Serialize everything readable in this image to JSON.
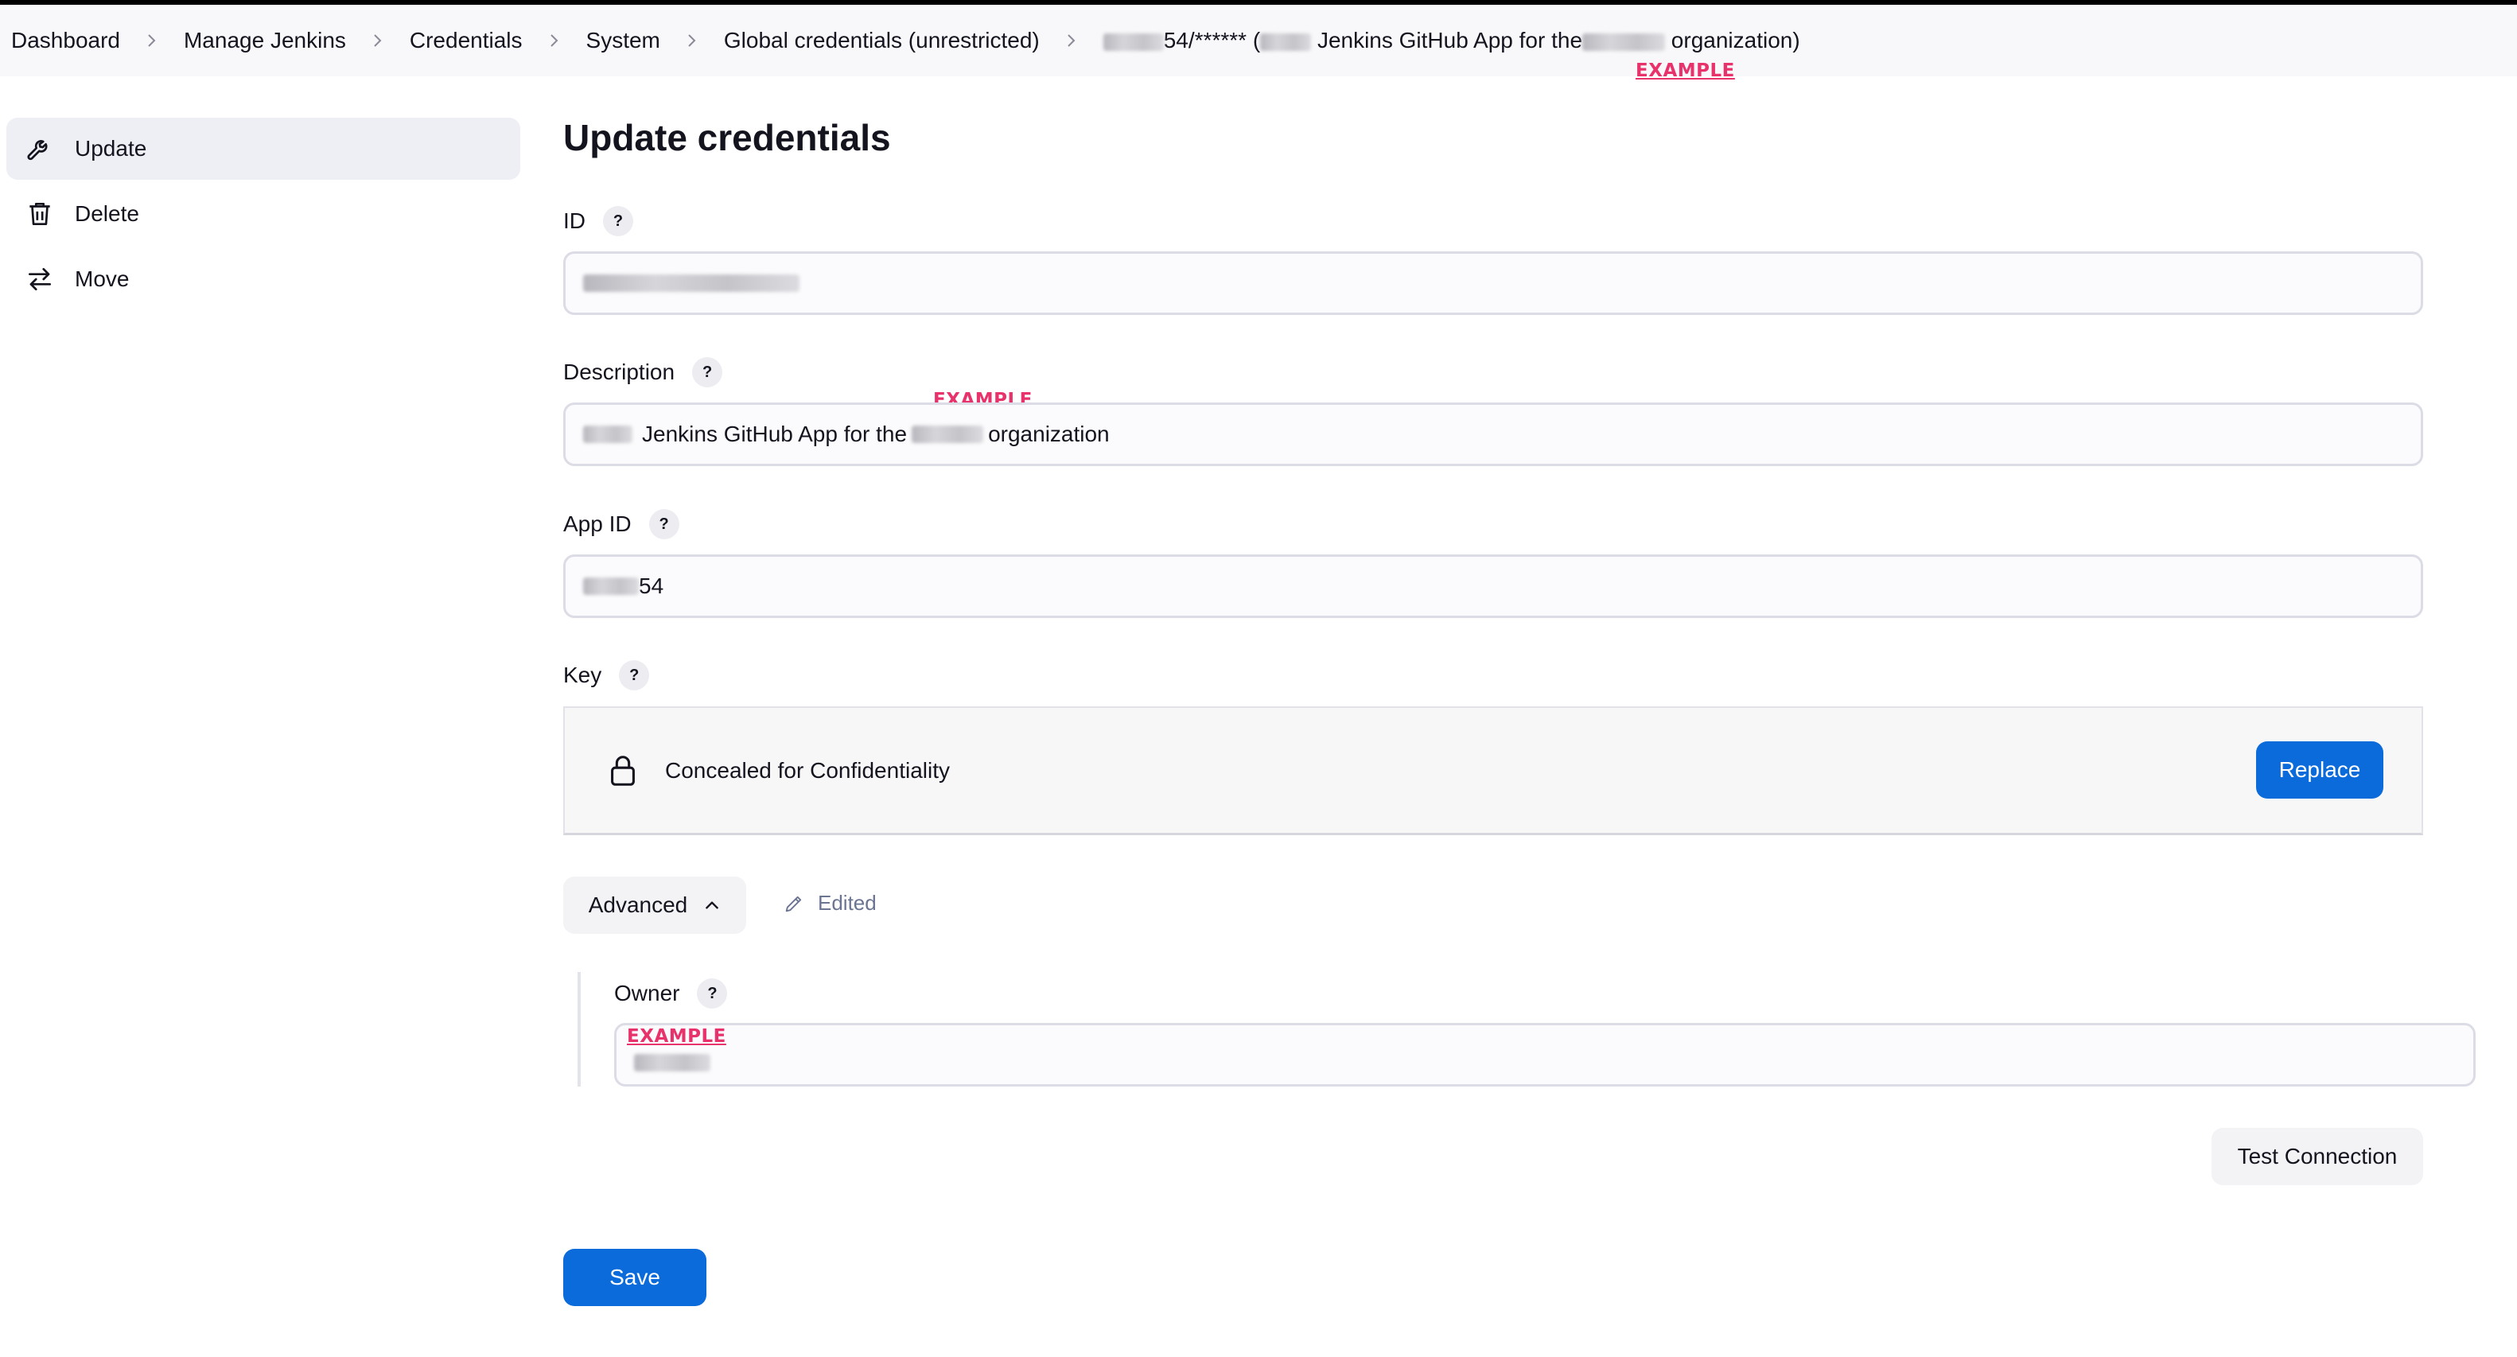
{
  "breadcrumb": {
    "items": [
      "Dashboard",
      "Manage Jenkins",
      "Credentials",
      "System",
      "Global credentials (unrestricted)"
    ],
    "current": {
      "app_id_suffix": "54/******",
      "paren_open": "(",
      "text": "Jenkins GitHub App for the",
      "text_end": "organization)"
    },
    "example_tag": "EXAMPLE"
  },
  "sidebar": {
    "items": [
      {
        "label": "Update",
        "icon": "wrench-icon",
        "active": true
      },
      {
        "label": "Delete",
        "icon": "trash-icon",
        "active": false
      },
      {
        "label": "Move",
        "icon": "move-arrows-icon",
        "active": false
      }
    ]
  },
  "form": {
    "title": "Update credentials",
    "help_glyph": "?",
    "id": {
      "label": "ID",
      "value": ""
    },
    "description": {
      "label": "Description",
      "value_middle": "Jenkins GitHub App for the",
      "value_end": "organization",
      "example_tag": "EXAMPLE"
    },
    "app_id": {
      "label": "App ID",
      "value_suffix": "54"
    },
    "key": {
      "label": "Key",
      "concealed_text": "Concealed for Confidentiality",
      "replace_label": "Replace",
      "icon": "lock-icon"
    },
    "advanced": {
      "label": "Advanced",
      "edited_label": "Edited"
    },
    "owner": {
      "label": "Owner",
      "example_tag": "EXAMPLE"
    },
    "test_connection_label": "Test Connection",
    "save_label": "Save"
  },
  "colors": {
    "primary": "#0b6bdb",
    "example_tag": "#e8326b",
    "text": "#14141f"
  }
}
